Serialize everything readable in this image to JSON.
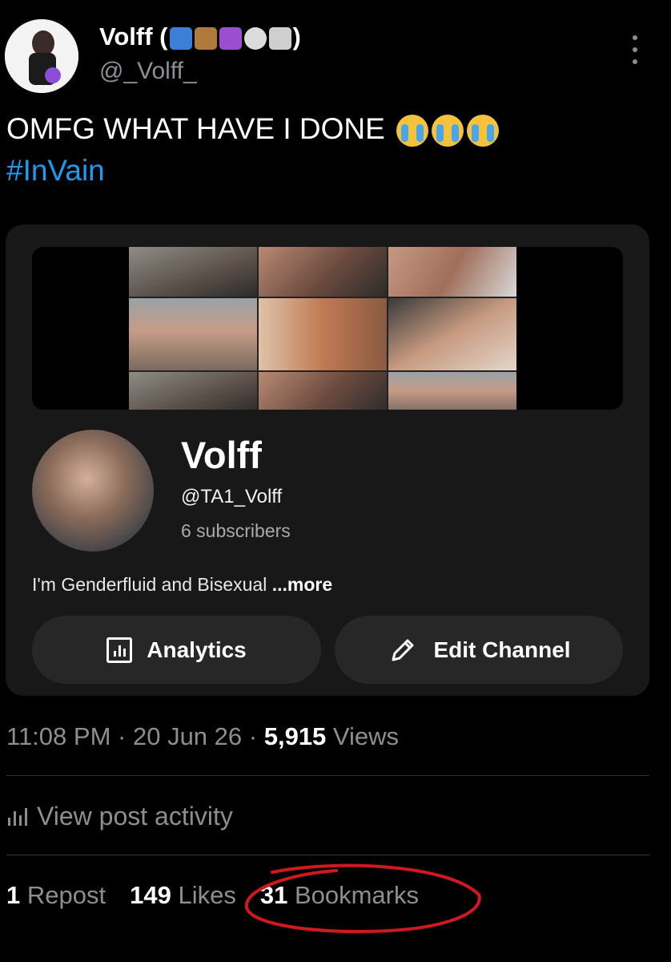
{
  "post": {
    "author": {
      "name": "Volff (",
      "name_suffix": ")",
      "emoji_icons": [
        "butterfly-emoji",
        "ox-emoji",
        "aries-emoji",
        "skull-emoji",
        "music-staff-emoji"
      ],
      "handle": "@_Volff_"
    },
    "text": "OMFG WHAT HAVE I DONE",
    "text_emojis": [
      "loudly-crying-face",
      "loudly-crying-face",
      "loudly-crying-face"
    ],
    "hashtag": "#InVain"
  },
  "embed": {
    "channel_name": "Volff",
    "channel_handle": "@TA1_Volff",
    "subscribers": "6 subscribers",
    "bio": "I'm Genderfluid and Bisexual",
    "bio_more": "...more",
    "analytics_label": "Analytics",
    "edit_label": "Edit Channel"
  },
  "meta": {
    "time": "11:08 PM",
    "sep": "·",
    "date": "20 Jun 26",
    "views_count": "5,915",
    "views_label": "Views"
  },
  "activity_label": "View post activity",
  "stats": {
    "reposts_count": "1",
    "reposts_label": "Repost",
    "likes_count": "149",
    "likes_label": "Likes",
    "bookmarks_count": "31",
    "bookmarks_label": "Bookmarks"
  },
  "colors": {
    "accent_link": "#1d9bf0",
    "muted_text": "#8b8f94",
    "annotation_red": "#d0191f"
  }
}
